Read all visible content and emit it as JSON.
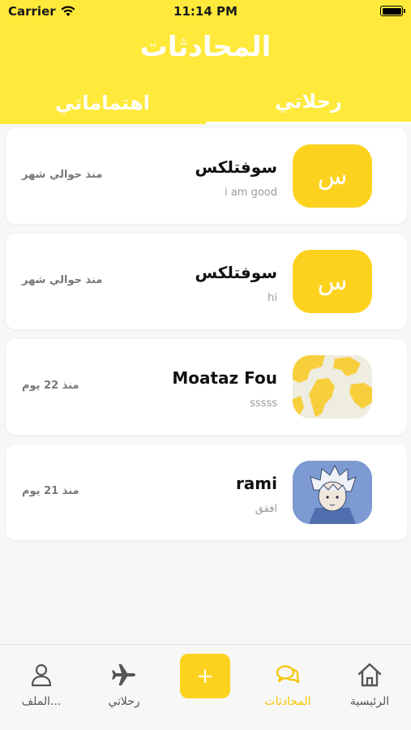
{
  "status_bar": {
    "carrier": "Carrier",
    "time": "11:14 PM"
  },
  "header": {
    "title": "المحادثات"
  },
  "tabs": [
    {
      "label": "رحلاتي",
      "active": true
    },
    {
      "label": "اهتماماتي",
      "active": false
    }
  ],
  "conversations": [
    {
      "name": "سوفتلكس",
      "preview": "i am good",
      "time": "منذ حوالي شهر",
      "avatar_letter": "س",
      "avatar": "letter"
    },
    {
      "name": "سوفتلكس",
      "preview": "hi",
      "time": "منذ حوالي شهر",
      "avatar_letter": "س",
      "avatar": "letter"
    },
    {
      "name": "Moataz Fou",
      "preview": "sssss",
      "time": "منذ 22 يوم",
      "avatar": "globe-map-image"
    },
    {
      "name": "rami",
      "preview": "افقق",
      "time": "منذ 21 يوم",
      "avatar": "anime-character-image"
    }
  ],
  "bottom_nav": {
    "items": [
      {
        "label": "الرئيسية",
        "icon": "home-icon",
        "active": false
      },
      {
        "label": "المحادثات",
        "icon": "chat-icon",
        "active": true
      },
      {
        "label": "+",
        "icon": "plus-icon",
        "active": false
      },
      {
        "label": "رحلاتي",
        "icon": "airplane-icon",
        "active": false
      },
      {
        "label": "الملف...",
        "icon": "profile-icon",
        "active": false
      }
    ]
  },
  "colors": {
    "accent": "#ffe93a",
    "avatar_yellow": "#fdd21e",
    "active_nav": "#f5c400"
  }
}
